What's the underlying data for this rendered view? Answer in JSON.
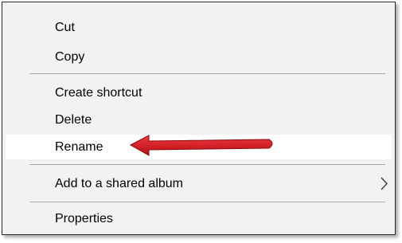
{
  "menu": {
    "items": [
      {
        "label": "Cut"
      },
      {
        "label": "Copy"
      },
      {
        "label": "Create shortcut"
      },
      {
        "label": "Delete"
      },
      {
        "label": "Rename"
      },
      {
        "label": "Add to a shared album"
      },
      {
        "label": "Properties"
      }
    ]
  },
  "annotation": {
    "arrow_color": "#e3141b",
    "points_to": "Rename"
  },
  "icons": {
    "submenu": "chevron-right-icon"
  }
}
